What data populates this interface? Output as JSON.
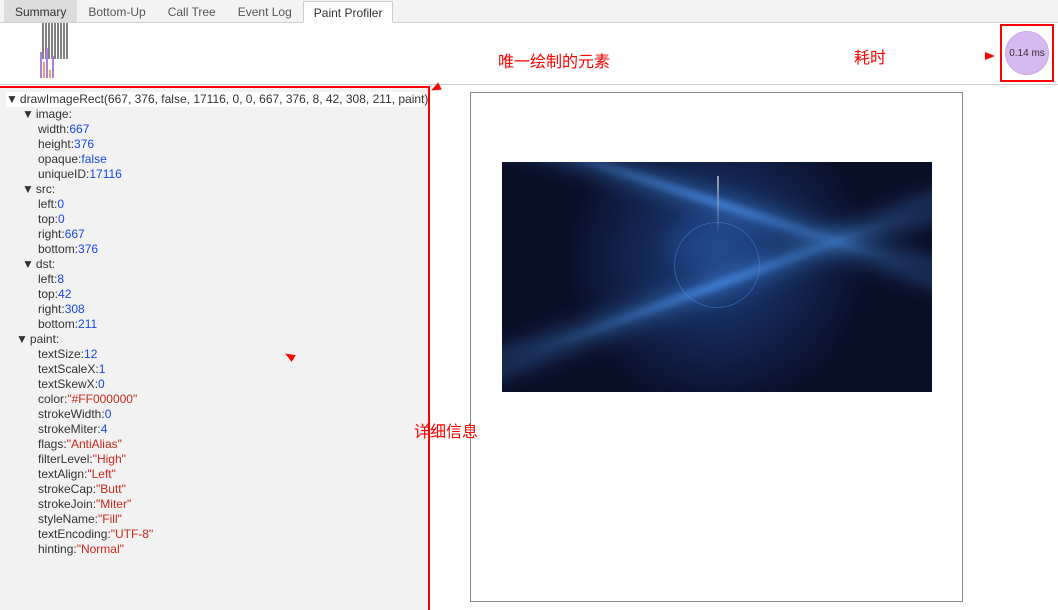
{
  "tabs": {
    "summary": "Summary",
    "bottomup": "Bottom-Up",
    "calltree": "Call Tree",
    "eventlog": "Event Log",
    "paint": "Paint Profiler"
  },
  "duration": "0.14 ms",
  "callouts": {
    "only_element": "唯一绘制的元素",
    "elapsed": "耗时",
    "details": "详细信息"
  },
  "tree": {
    "root": "drawImageRect(667, 376, false, 17116, 0, 0, 667, 376, 8, 42, 308, 211, paint)",
    "image": {
      "label": "image:",
      "width_k": "width:",
      "width_v": "667",
      "height_k": "height:",
      "height_v": "376",
      "opaque_k": "opaque:",
      "opaque_v": "false",
      "uid_k": "uniqueID:",
      "uid_v": "17116"
    },
    "src": {
      "label": "src:",
      "left_k": "left:",
      "left_v": "0",
      "top_k": "top:",
      "top_v": "0",
      "right_k": "right:",
      "right_v": "667",
      "bottom_k": "bottom:",
      "bottom_v": "376"
    },
    "dst": {
      "label": "dst:",
      "left_k": "left:",
      "left_v": "8",
      "top_k": "top:",
      "top_v": "42",
      "right_k": "right:",
      "right_v": "308",
      "bottom_k": "bottom:",
      "bottom_v": "211"
    },
    "paint": {
      "label": "paint:",
      "textSize_k": "textSize:",
      "textSize_v": "12",
      "textScaleX_k": "textScaleX:",
      "textScaleX_v": "1",
      "textSkewX_k": "textSkewX:",
      "textSkewX_v": "0",
      "color_k": "color:",
      "color_v": "\"#FF000000\"",
      "strokeWidth_k": "strokeWidth:",
      "strokeWidth_v": "0",
      "strokeMiter_k": "strokeMiter:",
      "strokeMiter_v": "4",
      "flags_k": "flags:",
      "flags_v": "\"AntiAlias\"",
      "filterLevel_k": "filterLevel:",
      "filterLevel_v": "\"High\"",
      "textAlign_k": "textAlign:",
      "textAlign_v": "\"Left\"",
      "strokeCap_k": "strokeCap:",
      "strokeCap_v": "\"Butt\"",
      "strokeJoin_k": "strokeJoin:",
      "strokeJoin_v": "\"Miter\"",
      "styleName_k": "styleName:",
      "styleName_v": "\"Fill\"",
      "textEncoding_k": "textEncoding:",
      "textEncoding_v": "\"UTF-8\"",
      "hinting_k": "hinting:",
      "hinting_v": "\"Normal\""
    }
  }
}
